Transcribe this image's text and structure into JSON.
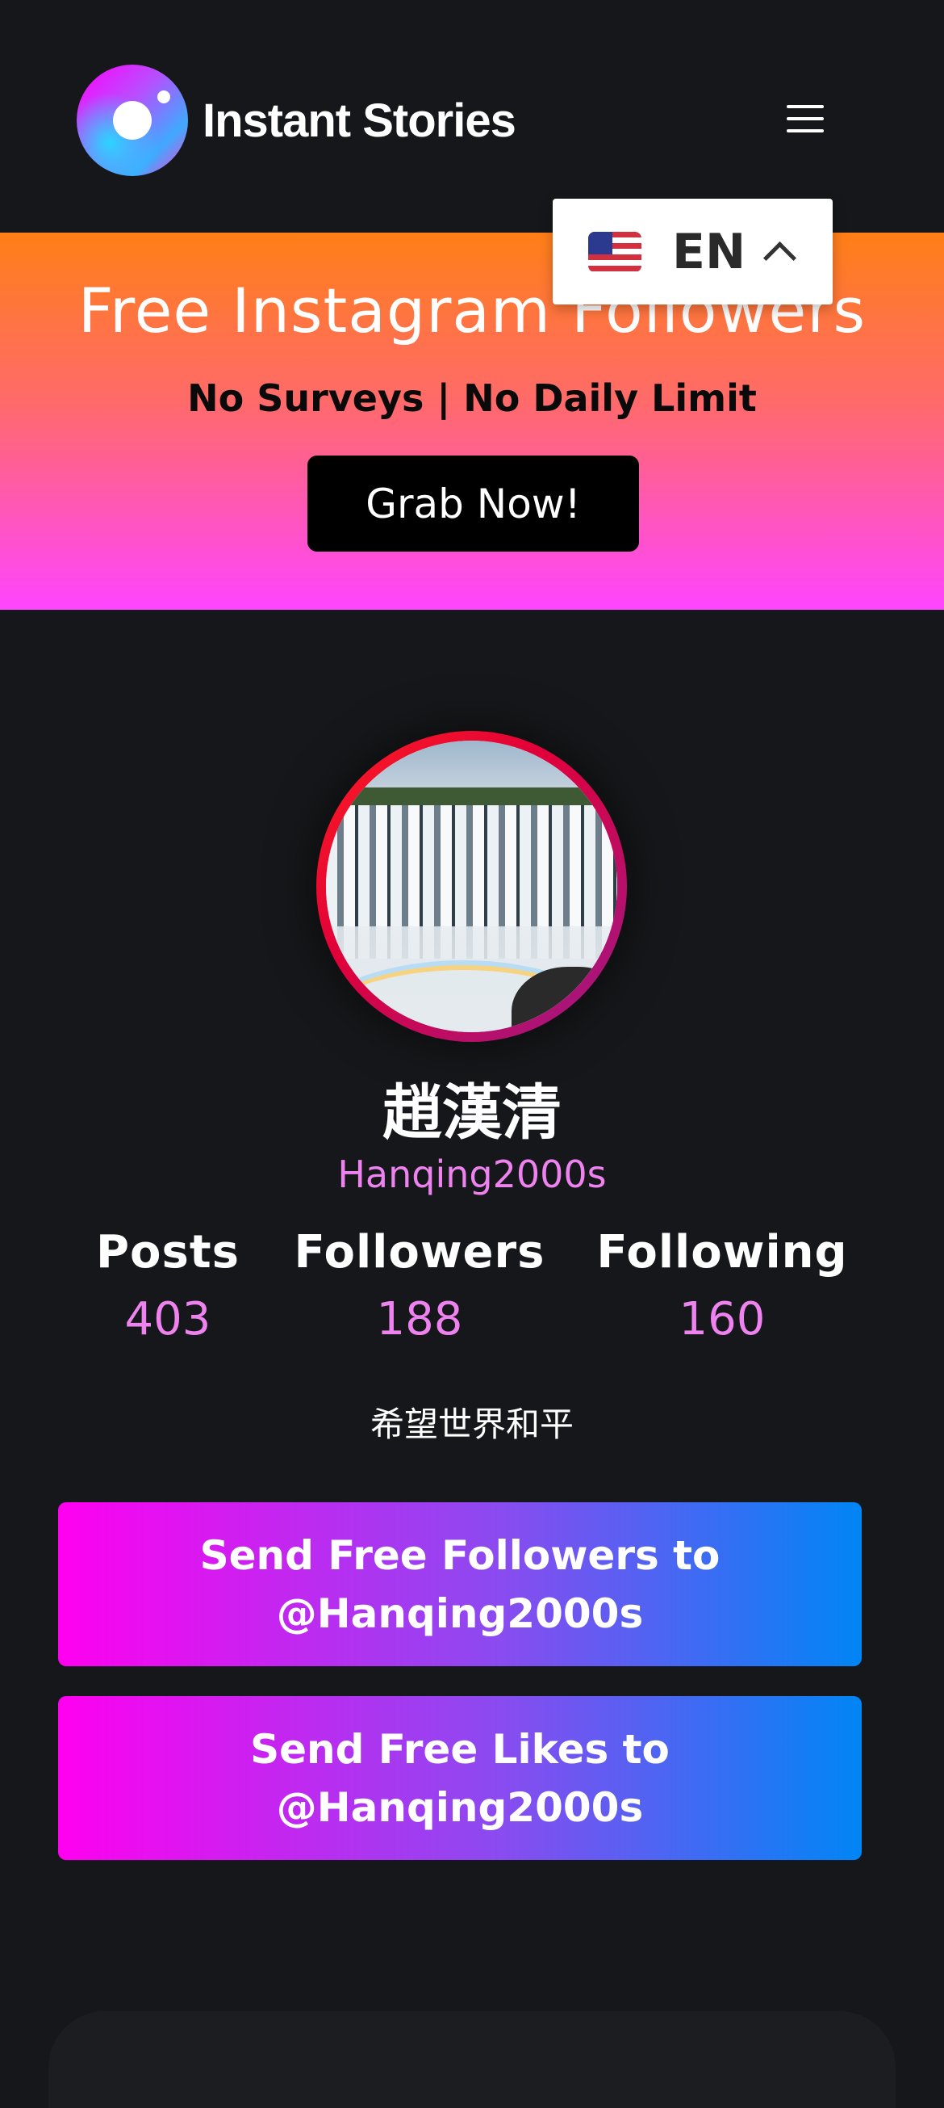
{
  "header": {
    "brand": "Instant Stories",
    "menu_icon": "hamburger-icon"
  },
  "language": {
    "flag_icon": "us-flag-icon",
    "code": "EN",
    "chevron_icon": "chevron-up-icon"
  },
  "hero": {
    "title": "Free Instagram Followers",
    "subtitle": "No Surveys | No Daily Limit",
    "button": "Grab Now!"
  },
  "profile": {
    "display_name": "趙漢清",
    "username": "Hanqing2000s",
    "bio": "希望世界和平",
    "stats": [
      {
        "label": "Posts",
        "value": "403"
      },
      {
        "label": "Followers",
        "value": "188"
      },
      {
        "label": "Following",
        "value": "160"
      }
    ]
  },
  "actions": {
    "followers": {
      "line1": "Send Free Followers to",
      "line2": "@Hanqing2000s"
    },
    "likes": {
      "line1": "Send Free Likes to",
      "line2": "@Hanqing2000s"
    }
  },
  "colors": {
    "background": "#16171a",
    "accent_pink": "#ee82ee",
    "gradient_start": "#ff00f0",
    "gradient_end": "#0085f5"
  }
}
